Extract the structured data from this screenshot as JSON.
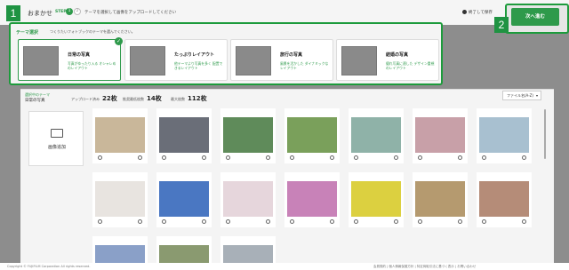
{
  "header": {
    "title": "おまかせ",
    "step_label": "STEP",
    "step1": "1",
    "step2": "2",
    "step_description": "テーマを選択して画像をアップロードしてください",
    "save_exit_label": "終了して保存",
    "next_label": "次へ進む"
  },
  "badges": {
    "one": "1",
    "two": "2"
  },
  "theme_select": {
    "label": "テーマ選択",
    "description": "つくりたいフォトブックのテーマを選んでください。",
    "cards": [
      {
        "title": "日常の写真",
        "desc": "写真がゆったり入る\nオシャレめのレイアウト",
        "selected": true
      },
      {
        "title": "たっぷりレイアウト",
        "desc": "他テーマより写真を多く\n配置できるレイアウト",
        "selected": false
      },
      {
        "title": "旅行の写真",
        "desc": "風景を活かした\nダイナミックなレイアウト",
        "selected": false
      },
      {
        "title": "結婚の写真",
        "desc": "優れ写真に適した\nデザイン重視のレイアウト",
        "selected": false
      }
    ]
  },
  "summary": {
    "selected_theme_label": "選択中のテーマ",
    "selected_theme_value": "日常の写真",
    "upload_label": "アップロード済み",
    "upload_value": "22枚",
    "recommended_label": "推奨最低枚数",
    "recommended_value": "14枚",
    "max_label": "最大枚数",
    "max_value": "112枚"
  },
  "sort": {
    "label": "ファイル名(A-Z)"
  },
  "grid": {
    "add_label": "画像追加",
    "photos": [
      {
        "color": "#c9b79a"
      },
      {
        "color": "#6a6e78"
      },
      {
        "color": "#5f8b5a"
      },
      {
        "color": "#7aa05b"
      },
      {
        "color": "#8fb2a8"
      },
      {
        "color": "#c8a0a8"
      },
      {
        "color": "#a8c0d0"
      },
      {
        "color": "#e8e4e0"
      },
      {
        "color": "#4a77c2"
      },
      {
        "color": "#e6d6dc"
      },
      {
        "color": "#c882b8"
      },
      {
        "color": "#dcd040"
      },
      {
        "color": "#b59a6f"
      },
      {
        "color": "#b58c78"
      },
      {
        "color": "#8aa0c8"
      },
      {
        "color": "#8a9a70"
      },
      {
        "color": "#a8b0b8"
      }
    ]
  },
  "footer": {
    "copyright": "Copyright © FUJIFILM Corporation All rights reserved.",
    "links": "会員規約 | 個人情報保護方針 | 特定商取引法に基づく表示 | お問い合わせ"
  }
}
